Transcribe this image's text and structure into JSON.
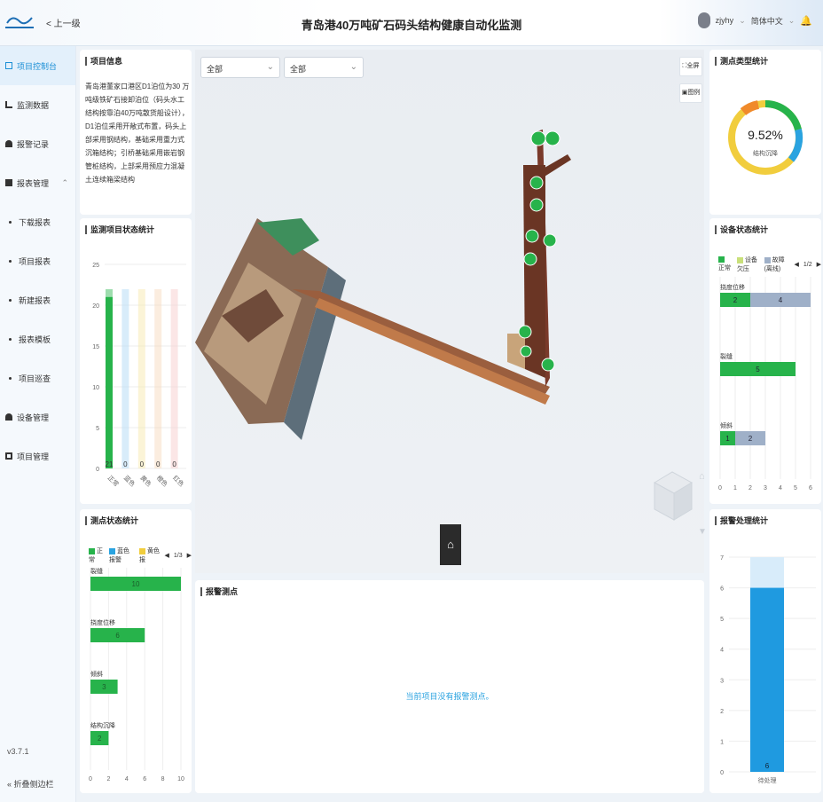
{
  "header": {
    "title": "青岛港40万吨矿石码头结构健康自动化监测",
    "back_label": "< 上一级",
    "username": "zjyhy",
    "language": "简体中文"
  },
  "sidebar": {
    "items": [
      {
        "label": "项目控制台",
        "icon": "console-icon",
        "active": true
      },
      {
        "label": "监测数据",
        "icon": "data-icon"
      },
      {
        "label": "报警记录",
        "icon": "alarm-icon"
      },
      {
        "label": "报表管理",
        "icon": "report-icon"
      },
      {
        "label": "下载报表",
        "icon": "dot"
      },
      {
        "label": "项目报表",
        "icon": "dot"
      },
      {
        "label": "新建报表",
        "icon": "dot"
      },
      {
        "label": "报表模板",
        "icon": "dot"
      },
      {
        "label": "项目巡查",
        "icon": "dot"
      },
      {
        "label": "设备管理",
        "icon": "device-icon"
      },
      {
        "label": "项目管理",
        "icon": "project-icon"
      }
    ],
    "version": "v3.7.1",
    "collapse_label": "« 折叠侧边栏"
  },
  "project_info": {
    "title": "项目信息",
    "text": "青岛港董家口港区D1泊位为30 万吨级铁矿石接卸泊位（码头水工结构按靠泊40万吨散货船设计），D1泊位采用开敞式布置，码头上部采用钢结构，基础采用重力式沉箱结构；引桥基础采用嵌岩钢管桩结构，上部采用预应力混凝土连续箱梁结构"
  },
  "scene": {
    "filter1": "全部",
    "filter2": "全部",
    "fullscreen_label": "全屏",
    "legend_label": "图例"
  },
  "point_type": {
    "title": "测点类型统计",
    "percent": "9.52%",
    "label": "结构沉降"
  },
  "project_status": {
    "title": "监测项目状态统计",
    "chart_data": {
      "type": "bar",
      "categories": [
        "正常",
        "蓝色",
        "黄色",
        "橙色",
        "红色"
      ],
      "values": [
        21,
        0,
        0,
        0,
        0
      ],
      "colors": [
        "#27b34b",
        "#a9d4f5",
        "#f7e7a6",
        "#f7d6b8",
        "#f7c7c7"
      ],
      "ylim": [
        0,
        25
      ],
      "yticks": [
        0,
        5,
        10,
        15,
        20,
        25
      ]
    }
  },
  "device_status": {
    "title": "设备状态统计",
    "legend": [
      {
        "label": "正常",
        "color": "#27b34b"
      },
      {
        "label": "设备欠压",
        "color": "#c9e07a"
      },
      {
        "label": "故障(离线)",
        "color": "#9fb0c8"
      }
    ],
    "page": "1/2",
    "chart_data": {
      "type": "bar",
      "categories": [
        "挠度位移",
        "裂缝",
        "倾斜"
      ],
      "series": [
        {
          "name": "正常",
          "values": [
            2,
            5,
            1
          ]
        },
        {
          "name": "故障(离线)",
          "values": [
            4,
            0,
            2
          ]
        }
      ],
      "xlim": [
        0,
        6
      ],
      "xticks": [
        0,
        1,
        2,
        3,
        4,
        5,
        6
      ]
    }
  },
  "point_status": {
    "title": "测点状态统计",
    "legend": [
      {
        "label": "正常",
        "color": "#27b34b"
      },
      {
        "label": "蓝色报警",
        "color": "#2aa3e0"
      },
      {
        "label": "黄色报",
        "color": "#f1cd3d"
      }
    ],
    "page": "1/3",
    "chart_data": {
      "type": "bar",
      "categories": [
        "裂缝",
        "挠度位移",
        "倾斜",
        "结构沉降"
      ],
      "values": [
        10,
        6,
        3,
        2
      ],
      "xlim": [
        0,
        10
      ],
      "xticks": [
        0,
        2,
        4,
        6,
        8,
        10
      ]
    }
  },
  "alarm_points": {
    "title": "报警测点",
    "empty_msg": "当前项目没有报警测点。"
  },
  "alarm_handle": {
    "title": "报警处理统计",
    "chart_data": {
      "type": "bar",
      "categories": [
        "待处理"
      ],
      "values": [
        6
      ],
      "ylim": [
        0,
        7
      ],
      "yticks": [
        0,
        1,
        2,
        3,
        4,
        5,
        6,
        7
      ]
    }
  }
}
